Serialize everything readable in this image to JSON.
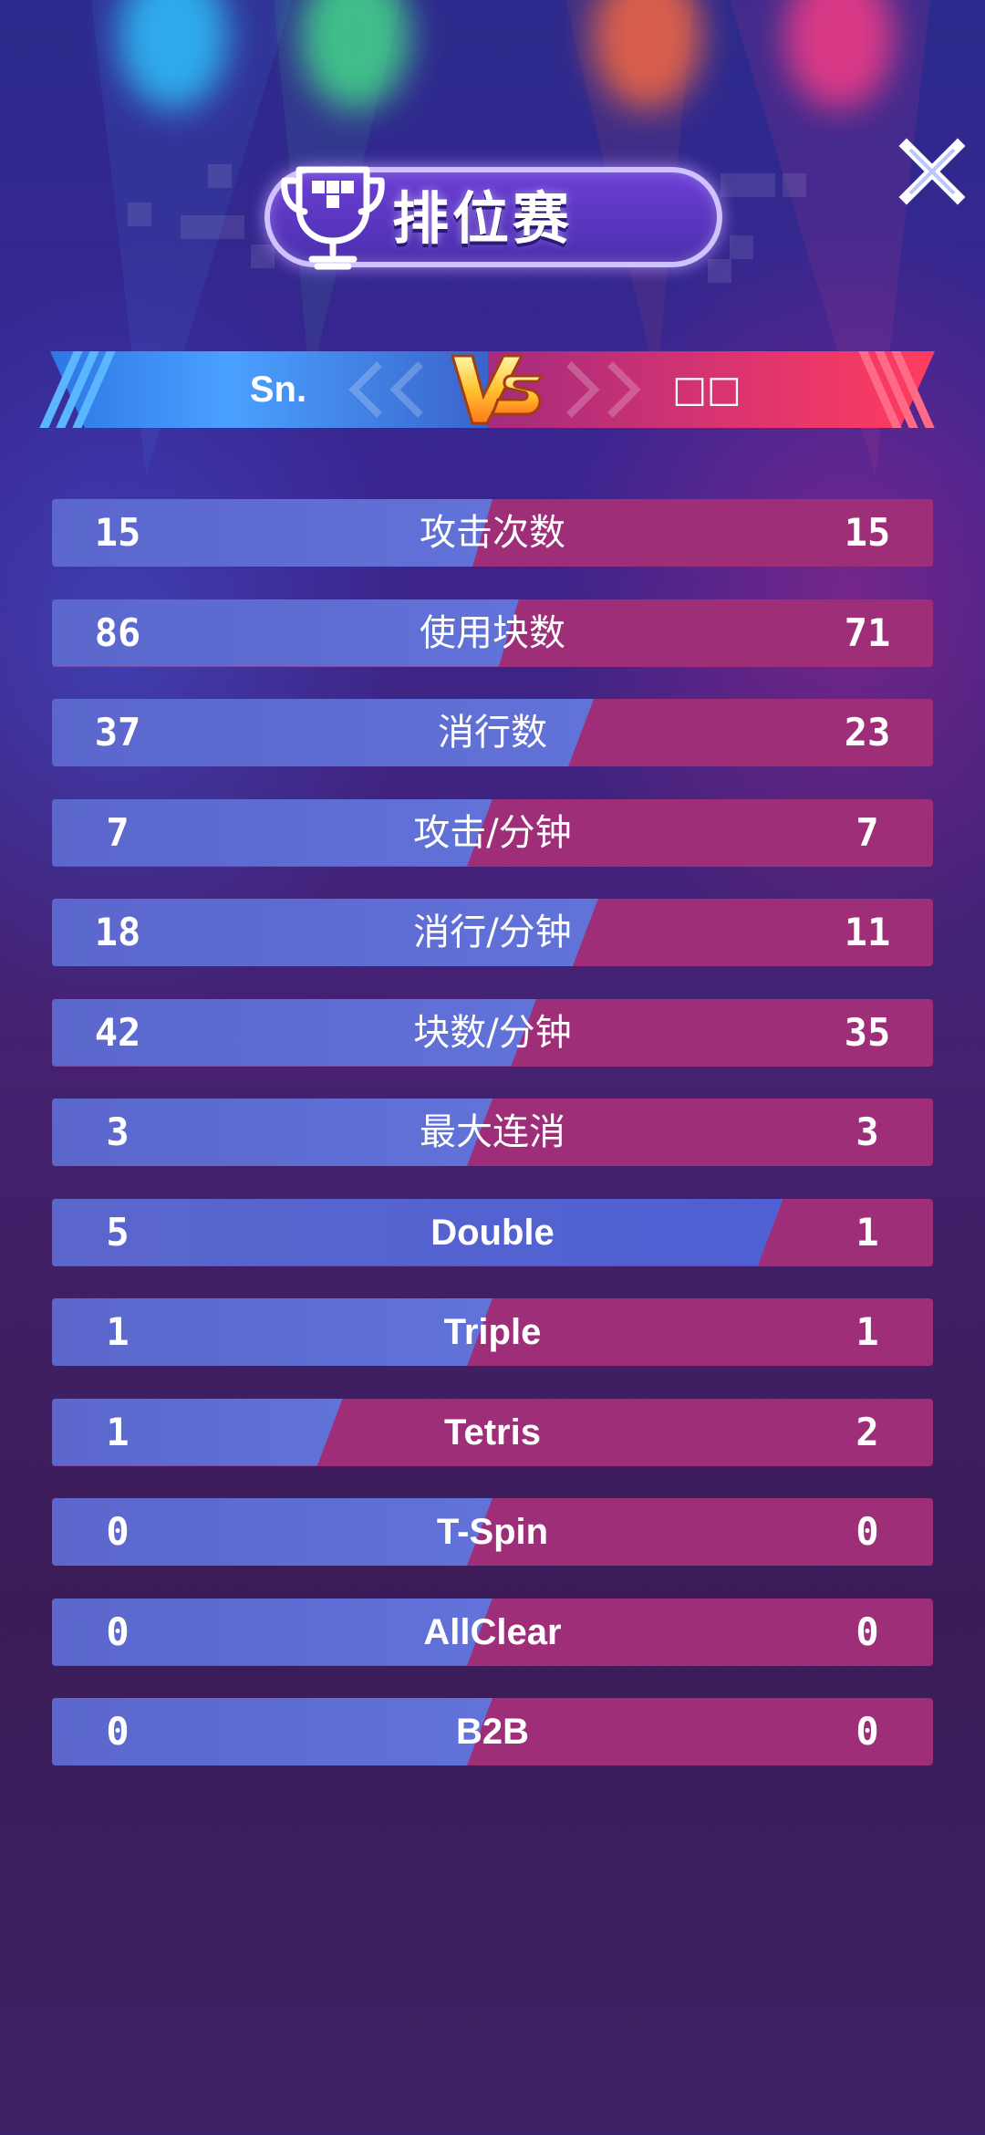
{
  "header": {
    "title": "排位赛"
  },
  "versus": {
    "left_player": "Sn.",
    "right_player": "□□",
    "vs_text": "VS"
  },
  "colors": {
    "left_team": "#5b67cc",
    "right_team": "#9f2e79",
    "title_border": "#cfc3ff"
  },
  "stats": [
    {
      "label": "攻击次数",
      "left": "15",
      "right": "15",
      "left_share": 0.5
    },
    {
      "label": "使用块数",
      "left": "86",
      "right": "71",
      "left_share": 0.55
    },
    {
      "label": "消行数",
      "left": "37",
      "right": "23",
      "left_share": 0.62
    },
    {
      "label": "攻击/分钟",
      "left": "7",
      "right": "7",
      "left_share": 0.5
    },
    {
      "label": "消行/分钟",
      "left": "18",
      "right": "11",
      "left_share": 0.62
    },
    {
      "label": "块数/分钟",
      "left": "42",
      "right": "35",
      "left_share": 0.55
    },
    {
      "label": "最大连消",
      "left": "3",
      "right": "3",
      "left_share": 0.5
    },
    {
      "label": "Double",
      "left": "5",
      "right": "1",
      "left_share": 0.83
    },
    {
      "label": "Triple",
      "left": "1",
      "right": "1",
      "left_share": 0.5
    },
    {
      "label": "Tetris",
      "left": "1",
      "right": "2",
      "left_share": 0.33
    },
    {
      "label": "T-Spin",
      "left": "0",
      "right": "0",
      "left_share": 0.5
    },
    {
      "label": "AllClear",
      "left": "0",
      "right": "0",
      "left_share": 0.5
    },
    {
      "label": "B2B",
      "left": "0",
      "right": "0",
      "left_share": 0.5
    }
  ],
  "icons": {
    "title": "trophy-icon",
    "close": "close-icon",
    "versus": "vs-icon"
  }
}
